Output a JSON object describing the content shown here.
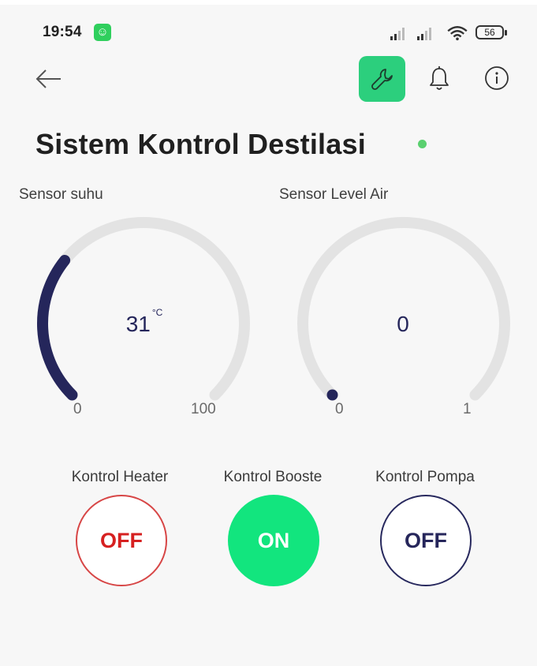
{
  "status_bar": {
    "time": "19:54",
    "battery_level": "56",
    "icons": [
      "app-notification-icon",
      "signal-icon",
      "signal-icon",
      "wifi-icon",
      "battery-icon"
    ]
  },
  "toolbar": {
    "icons": [
      "back-arrow-icon",
      "wrench-icon",
      "bell-icon",
      "info-icon"
    ],
    "accent_color": "#2ccf7d"
  },
  "page": {
    "title": "Sistem Kontrol Destilasi",
    "online_status_color": "#5ad06f"
  },
  "gauges": [
    {
      "label": "Sensor suhu",
      "value": "31",
      "unit": "°C",
      "min": "0",
      "max": "100",
      "fill_fraction": 0.31,
      "fill_color": "#25265b",
      "track_color": "#e3e3e3"
    },
    {
      "label": "Sensor Level Air",
      "value": "0",
      "unit": "",
      "min": "0",
      "max": "1",
      "fill_fraction": 0,
      "fill_color": "#25265b",
      "track_color": "#e3e3e3"
    }
  ],
  "controls": [
    {
      "label": "Kontrol Heater",
      "state": "OFF",
      "color": "#d62020"
    },
    {
      "label": "Kontrol Booste",
      "state": "ON",
      "color": "#12e57e"
    },
    {
      "label": "Kontrol Pompa",
      "state": "OFF",
      "color": "#26265b"
    }
  ]
}
